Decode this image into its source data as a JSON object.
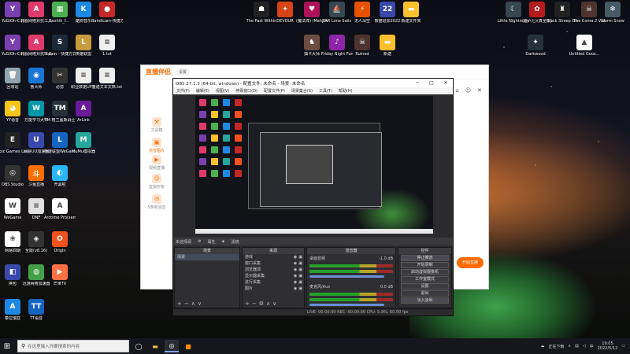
{
  "desktop": {
    "left_icons": [
      {
        "label": "YuGiOh-C...",
        "color": "#7a3fb0",
        "glyph": "Y"
      },
      {
        "label": "韩服网络对抗工具",
        "color": "#e03a6b",
        "glyph": "A"
      },
      {
        "label": "tezhih_f...",
        "color": "#4caf50",
        "glyph": "▦"
      },
      {
        "label": "酷狗音乐",
        "color": "#1e88e5",
        "glyph": "K"
      },
      {
        "label": "Bandicam-快捷方式",
        "color": "#c62828",
        "glyph": "●"
      },
      {
        "label": "YuGiOh-C...",
        "color": "#7a3fb0",
        "glyph": "Y"
      },
      {
        "label": "韩服网络对抗工具",
        "color": "#e03a6b",
        "glyph": "A"
      },
      {
        "label": "Steam - 快捷方式",
        "color": "#1b2838",
        "glyph": "S"
      },
      {
        "label": "英雄联盟",
        "color": "#c89b3c",
        "glyph": "L"
      },
      {
        "label": "1.txt",
        "color": "#eeeeee",
        "glyph": "≡"
      },
      {
        "label": "回收站",
        "color": "#90a4ae",
        "glyph": "🗑"
      },
      {
        "label": "鲁大师",
        "color": "#1976d2",
        "glyph": "◉"
      },
      {
        "label": "必剪",
        "color": "#333333",
        "glyph": "✂"
      },
      {
        "label": "职业数据UP主",
        "color": "#eeeeee",
        "glyph": "≡"
      },
      {
        "label": "新建文本文档.txt",
        "color": "#eeeeee",
        "glyph": "≡"
      },
      {
        "label": "YY语音",
        "color": "#f5c518",
        "glyph": "◕"
      },
      {
        "label": "万能学习大师",
        "color": "#0097a7",
        "glyph": "W"
      },
      {
        "label": "TM 格兰盖斯战士",
        "color": "#263238",
        "glyph": "TM"
      },
      {
        "label": "ArLink",
        "color": "#6a1b9a",
        "glyph": "A"
      },
      {
        "label": "Epic Games Launcher",
        "color": "#222222",
        "glyph": "E"
      },
      {
        "label": "网易UU加速器",
        "color": "#3949ab",
        "glyph": "U"
      },
      {
        "label": "英雄联盟WeGame版",
        "color": "#1565c0",
        "glyph": "L"
      },
      {
        "label": "MuMu模拟器",
        "color": "#26a69a",
        "glyph": "M"
      },
      {
        "label": "OBS Studio",
        "color": "#333333",
        "glyph": "◎"
      },
      {
        "label": "斗鱼直播",
        "color": "#ff6f00",
        "glyph": "斗"
      },
      {
        "label": "开黑啦",
        "color": "#29b6f6",
        "glyph": "◐"
      },
      {
        "label": "WeGame",
        "color": "#ffffff",
        "glyph": "W"
      },
      {
        "label": "DNF",
        "color": "#e0e0e0",
        "glyph": "≡"
      },
      {
        "label": "Arctime Pro(sem...",
        "color": "#ffffff",
        "glyph": "A"
      },
      {
        "label": "网易四期",
        "color": "#ffffff",
        "glyph": "❀"
      },
      {
        "label": "全能(v8.16)",
        "color": "#333333",
        "glyph": "◈"
      },
      {
        "label": "Origin",
        "color": "#f4511e",
        "glyph": "O"
      },
      {
        "label": "换包",
        "color": "#3949ab",
        "glyph": "◧"
      },
      {
        "label": "迅游网络加速器",
        "color": "#43a047",
        "glyph": "◍"
      },
      {
        "label": "芒果TV",
        "color": "#ff7043",
        "glyph": "▶"
      },
      {
        "label": "泰拉瑞亚",
        "color": "#1e88e5",
        "glyph": "A"
      },
      {
        "label": "TT语音",
        "color": "#1565c0",
        "glyph": "TT"
      }
    ],
    "top_icons": [
      {
        "label": "The Past Within",
        "color": "#222222",
        "glyph": "☗"
      },
      {
        "label": "DEVOUR",
        "color": "#d84315",
        "glyph": "✦"
      },
      {
        "label": "(魔法阵) (Mahjong)",
        "color": "#ad1457",
        "glyph": "♥"
      },
      {
        "label": "FAR Lone Sails",
        "color": "#37474f",
        "glyph": "⛵"
      },
      {
        "label": "无人深空",
        "color": "#e65100",
        "glyph": "⚡"
      },
      {
        "label": "熊猫追加2022",
        "color": "#3949ab",
        "glyph": "22"
      },
      {
        "label": "新建文件夹",
        "color": "#fbc02d",
        "glyph": "▬"
      },
      {
        "label": "抽卡大师",
        "color": "#6d4c41",
        "glyph": "♞"
      },
      {
        "label": "Friday Night Funkin",
        "color": "#8e24aa",
        "glyph": "♪"
      },
      {
        "label": "Ruined",
        "color": "#4e342e",
        "glyph": "☠"
      },
      {
        "label": "新建",
        "color": "#fbc02d",
        "glyph": "▬"
      }
    ],
    "right_icons": [
      {
        "label": "Little Nightmares",
        "color": "#37474f",
        "glyph": "☾"
      },
      {
        "label": "(伍六七)(真全版)",
        "color": "#b71c1c",
        "glyph": "✿"
      },
      {
        "label": "Black Sheep Demo",
        "color": "#212121",
        "glyph": "♜"
      },
      {
        "label": "The Coma 2 Vicious Sis...",
        "color": "#4e342e",
        "glyph": "☠"
      },
      {
        "label": "Warm Snow",
        "color": "#455a64",
        "glyph": "❄"
      },
      {
        "label": "Darkwood",
        "color": "#263238",
        "glyph": "✦"
      },
      {
        "label": "Untitled Goos...",
        "color": "#ffffff",
        "glyph": "▲"
      }
    ]
  },
  "live_window": {
    "brand": "直播伴侣",
    "badge": "设置",
    "side_items": [
      {
        "label": "工具箱",
        "icon": "toolbox-icon",
        "glyph": "⚒"
      },
      {
        "label": "抖音图片",
        "icon": "image-icon",
        "glyph": "▣"
      },
      {
        "label": "视频直播",
        "icon": "video-icon",
        "glyph": "▶"
      },
      {
        "label": "虚拟形象",
        "icon": "avatar-icon",
        "glyph": "☺"
      },
      {
        "label": "5条新消息",
        "icon": "message-icon",
        "glyph": "✉"
      }
    ],
    "start_button": "开始直播"
  },
  "obs": {
    "title": "OBS 27.1.3 (64-bit, windows) - 配置文件: 未命名 - 场景: 未命名",
    "menu": [
      "文件(F)",
      "编辑(E)",
      "视图(V)",
      "停靠窗口(D)",
      "配置文件(P)",
      "场景集合(S)",
      "工具(T)",
      "帮助(H)"
    ],
    "source_bar_label": "未选择源",
    "source_bar_props": "属性",
    "source_bar_filters": "滤镜",
    "docks": {
      "scenes": {
        "title": "场景",
        "items": [
          "场景"
        ]
      },
      "sources": {
        "title": "来源",
        "items": [
          "游戏",
          "窗口采集",
          "浏览器源",
          "显示器采集",
          "进行采集",
          "图片"
        ]
      },
      "mixer": {
        "title": "混音器",
        "tracks": [
          {
            "name": "桌面音频",
            "level": "-1.0 dB"
          },
          {
            "name": "麦克风/Aux",
            "level": "0.0 dB"
          }
        ]
      },
      "transitions": {
        "title": "转场",
        "mode": "淡入淡出"
      },
      "controls": {
        "title": "控件",
        "buttons": [
          "停止推流",
          "开始录制",
          "启动虚拟摄像机",
          "工作室模式",
          "设置",
          "退出"
        ]
      }
    },
    "status": "LIVE: 00:00:00    REC: 00:00:00    CPU: 5.9%, 60.00 fps"
  },
  "taskbar": {
    "search_placeholder": "在这里输入你要搜索的内容",
    "weather": "正在下雨",
    "time": "19:05",
    "date": "2022/5/12"
  }
}
